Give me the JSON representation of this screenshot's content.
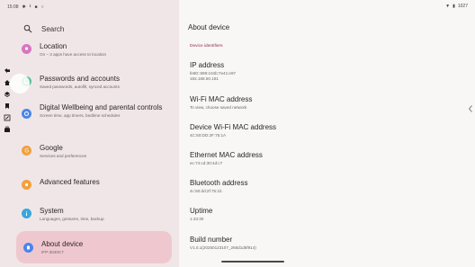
{
  "status_bar": {
    "time": "15:08",
    "battery": "1027"
  },
  "search": {
    "label": "Search"
  },
  "nav": {
    "items": [
      {
        "id": "location",
        "title": "Location",
        "subtitle": "On – 3 apps have access to location",
        "color": "#d876c0"
      },
      {
        "id": "passwords",
        "title": "Passwords and accounts",
        "subtitle": "Saved passwords, autofill, synced accounts",
        "color": "#5cc39a"
      },
      {
        "id": "digital-wellbeing",
        "title": "Digital Wellbeing and parental controls",
        "subtitle": "Screen time, app timers, bedtime schedules",
        "color": "#4a86e8"
      },
      {
        "id": "google",
        "title": "Google",
        "subtitle": "Services and preferences",
        "color": "#f2a13d"
      },
      {
        "id": "advanced",
        "title": "Advanced features",
        "subtitle": "",
        "color": "#f2a13d"
      },
      {
        "id": "system",
        "title": "System",
        "subtitle": "Languages, gestures, time, backup",
        "color": "#3aa6d9"
      },
      {
        "id": "about",
        "title": "About device",
        "subtitle": "IFP-3040C7",
        "color": "#4a86e8"
      }
    ]
  },
  "detail": {
    "title": "About device",
    "section": "Device identifiers",
    "rows": [
      {
        "title": "IP address",
        "value": "fe80::699:104b:7e41:e97\n192.168.50.181"
      },
      {
        "title": "Wi-Fi MAC address",
        "value": "To view, choose saved network"
      },
      {
        "title": "Device Wi-Fi MAC address",
        "value": "4C:50:DD:2F:75:1A"
      },
      {
        "title": "Ethernet MAC address",
        "value": "ec:74:cd:30:4d:c7"
      },
      {
        "title": "Bluetooth address",
        "value": "4c:50:dd:2f:75:1b"
      },
      {
        "title": "Uptime",
        "value": "1:43:30"
      },
      {
        "title": "Build number",
        "value": "V1.0.1(20250123107_268d1d6f914)"
      }
    ]
  }
}
